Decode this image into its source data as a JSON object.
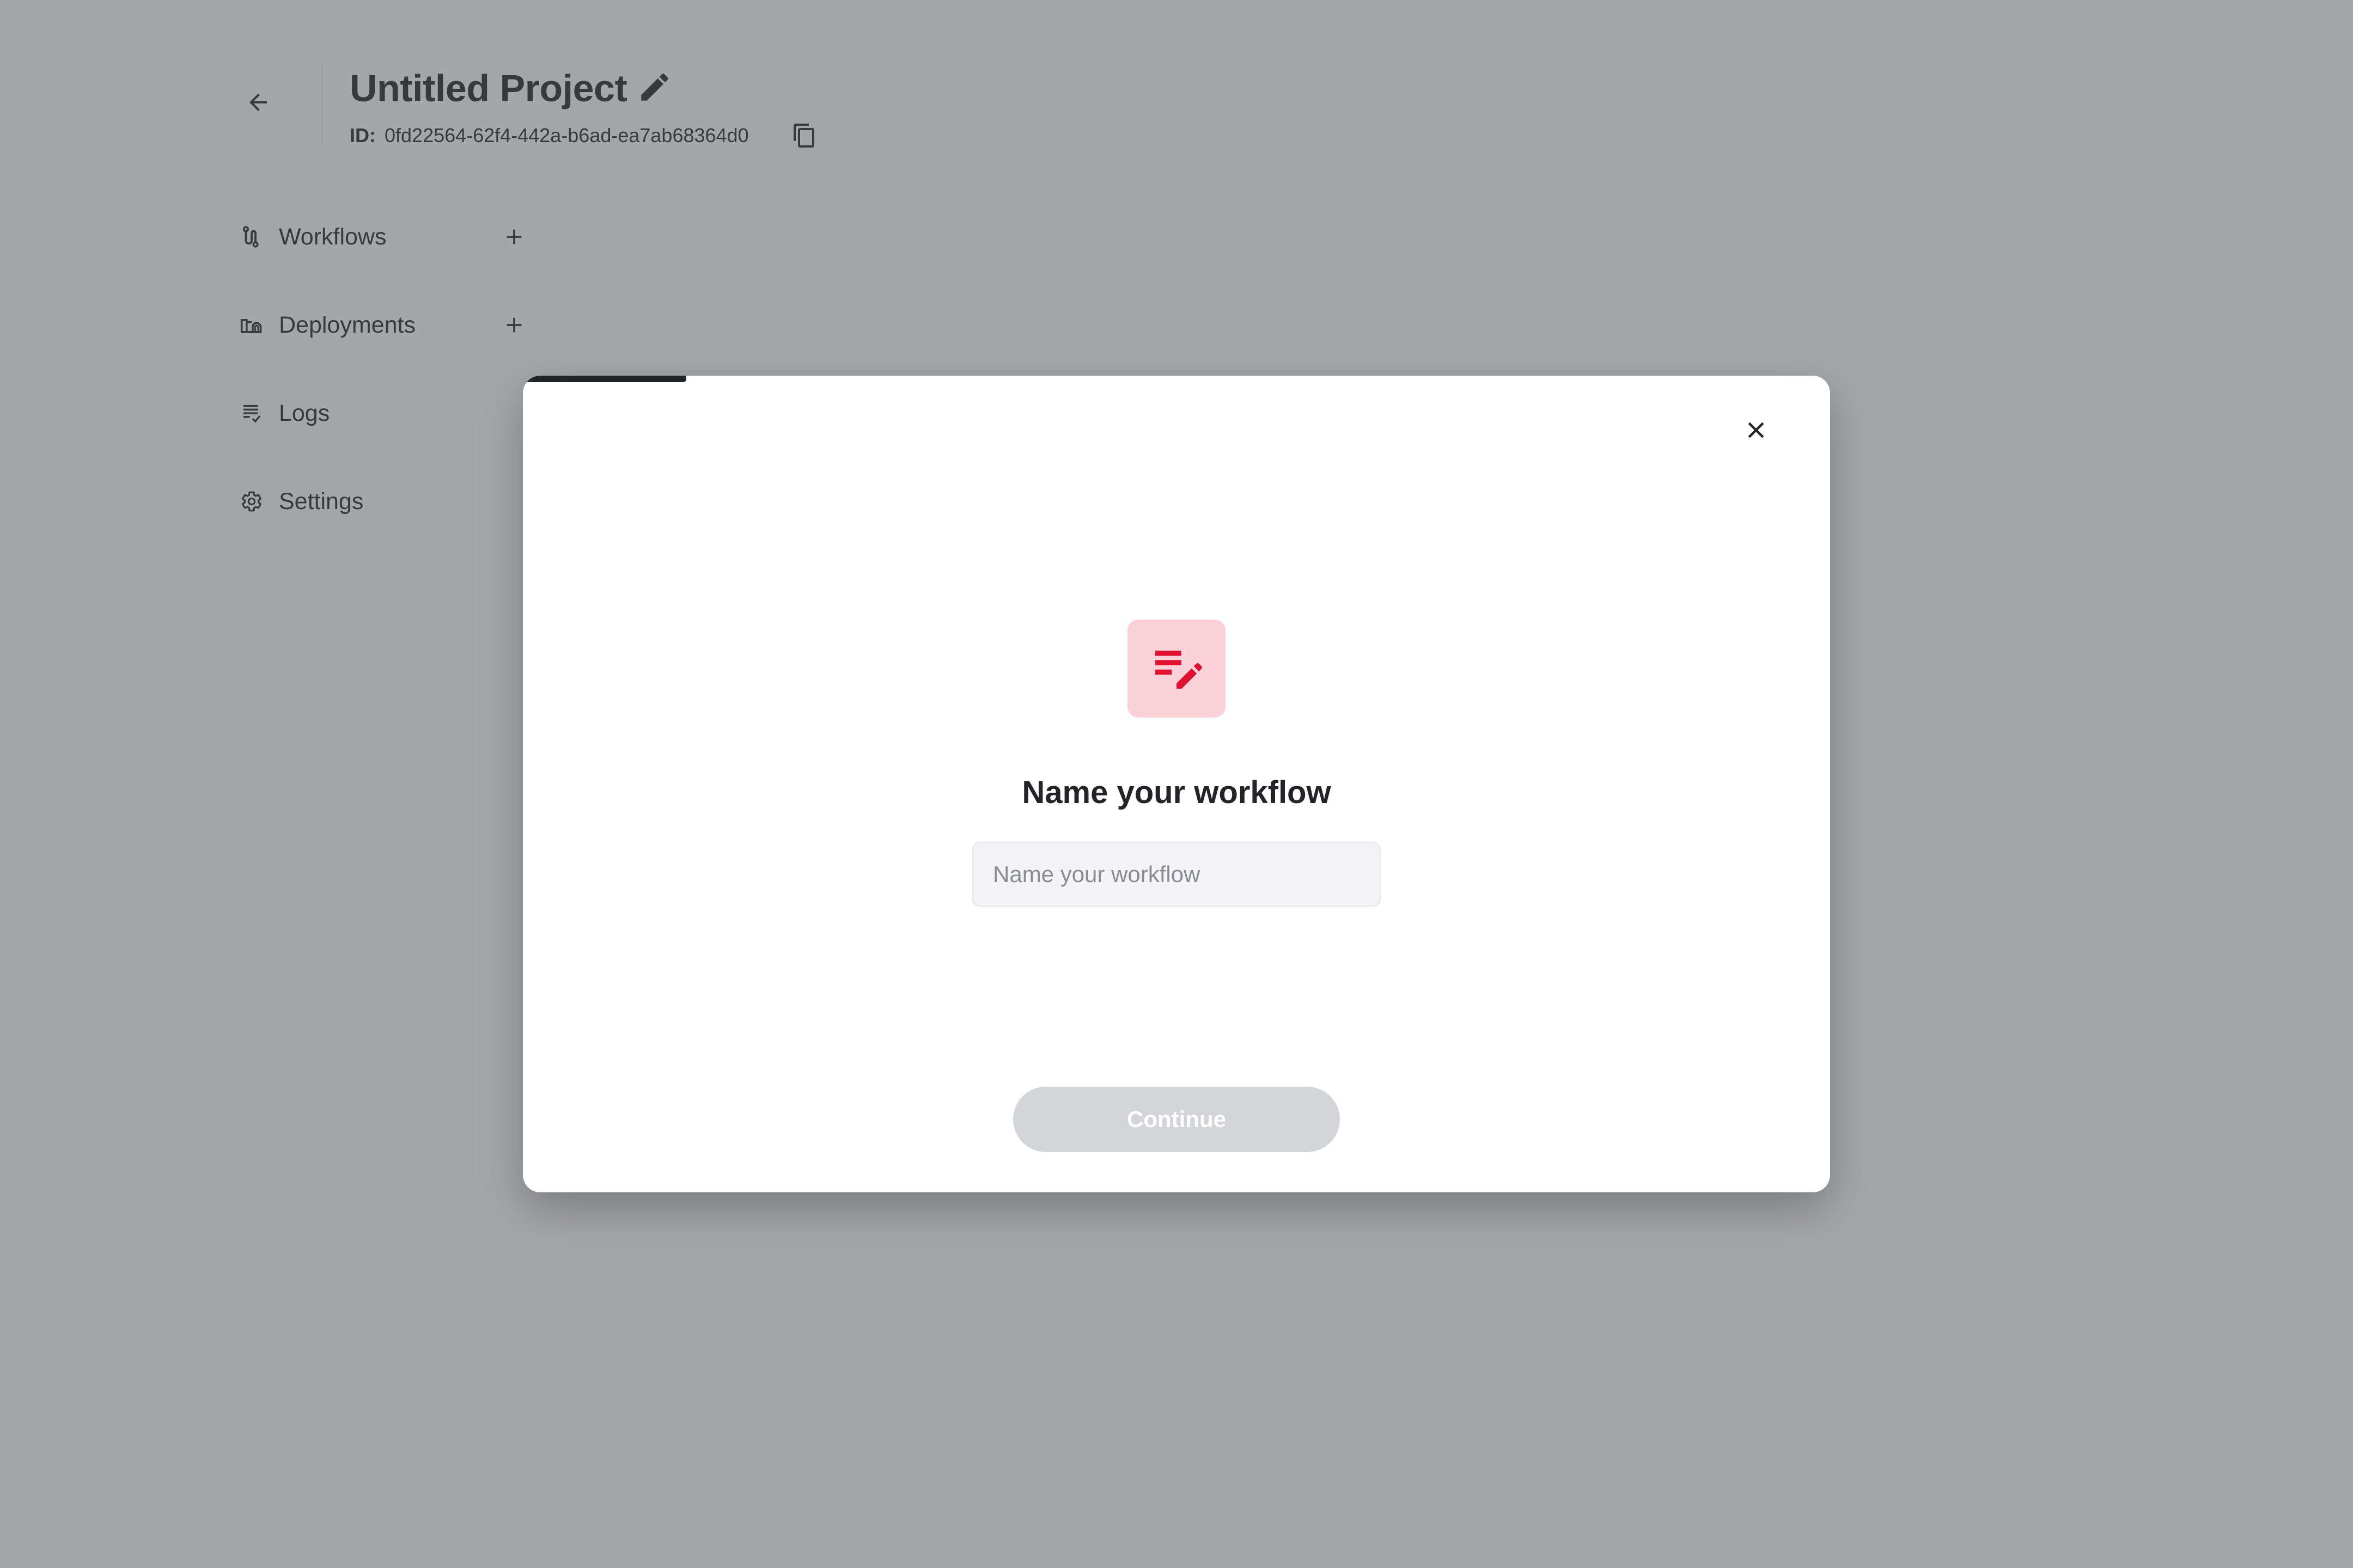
{
  "header": {
    "back_icon": "arrow-left-icon",
    "project_title": "Untitled Project",
    "edit_icon": "pencil-icon",
    "id_label": "ID:",
    "id_value": "0fd22564-62f4-442a-b6ad-ea7ab68364d0",
    "copy_icon": "copy-icon"
  },
  "sidebar": {
    "items": [
      {
        "label": "Workflows",
        "icon": "workflow-icon",
        "has_add": true,
        "add_icon": "plus-icon"
      },
      {
        "label": "Deployments",
        "icon": "deployment-icon",
        "has_add": true,
        "add_icon": "plus-icon"
      },
      {
        "label": "Logs",
        "icon": "logs-icon",
        "has_add": false
      },
      {
        "label": "Settings",
        "icon": "gear-icon",
        "has_add": false
      }
    ]
  },
  "modal": {
    "progress_fraction": 0.125,
    "close_icon": "close-icon",
    "hero_icon": "edit-note-icon",
    "title": "Name your workflow",
    "input": {
      "value": "",
      "placeholder": "Name your workflow"
    },
    "continue_label": "Continue",
    "continue_disabled": true
  },
  "colors": {
    "text": "#232427",
    "overlay": "#4c4e54",
    "icon_bg": "#fad2d8",
    "icon_fg": "#e0102f",
    "button_disabled_bg": "#d4d5d8",
    "input_bg": "#f4f4f7",
    "progress": "#232427"
  }
}
